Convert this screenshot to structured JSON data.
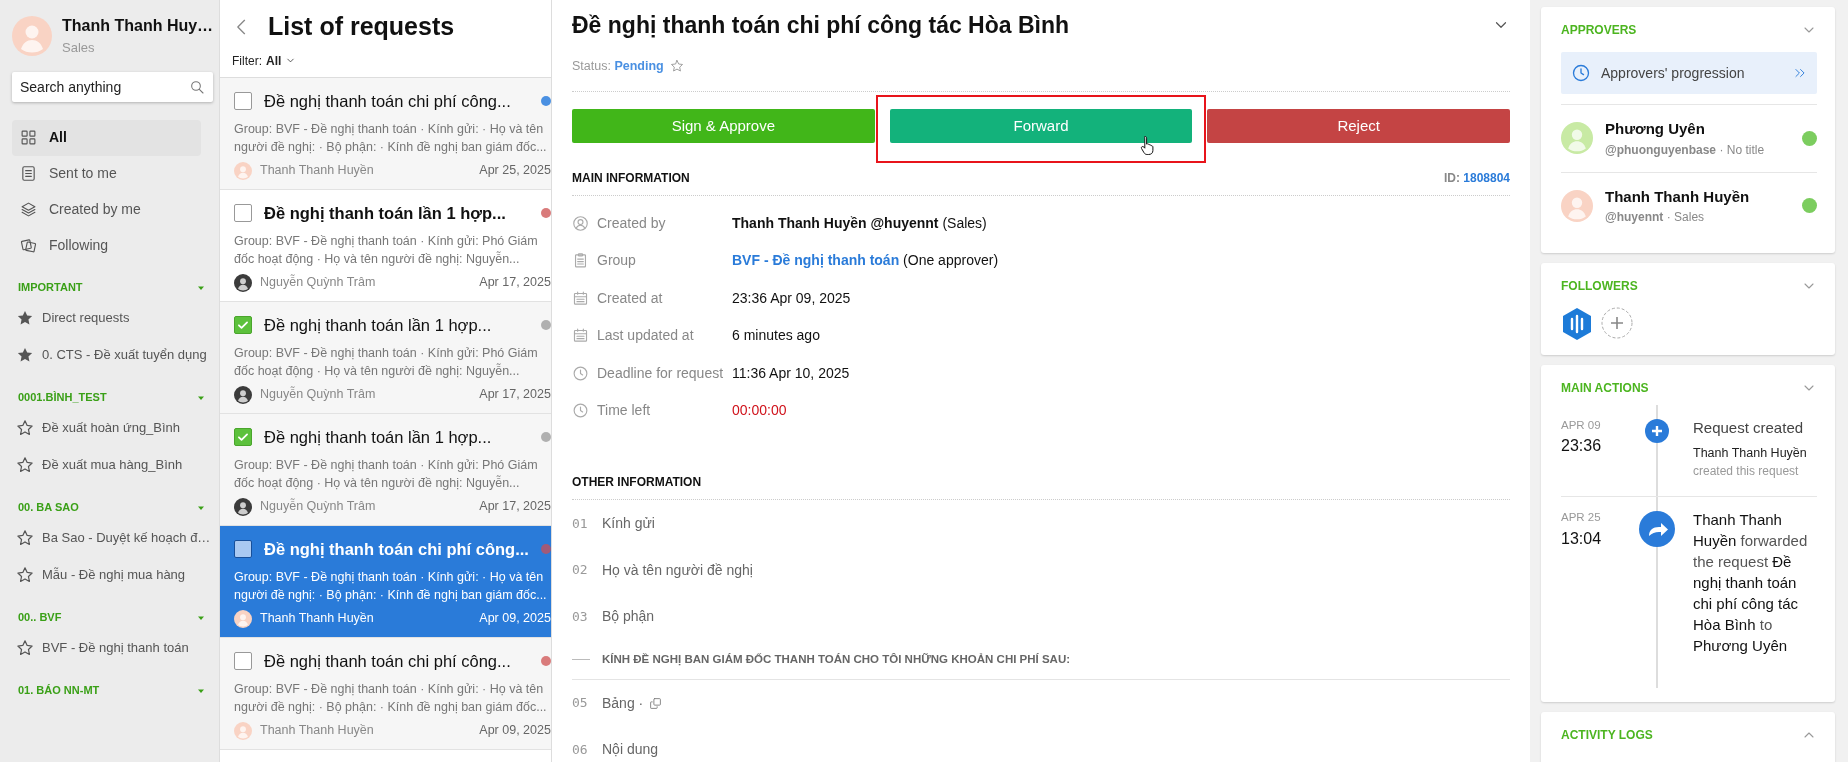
{
  "sidebar": {
    "user": {
      "name": "Thanh Thanh Huy…",
      "role": "Sales",
      "avatar": {
        "color": "#f9d3c4"
      }
    },
    "search": {
      "placeholder": "Search anything"
    },
    "nav": [
      {
        "label": "All",
        "selected": true
      },
      {
        "label": "Sent to me",
        "selected": false
      },
      {
        "label": "Created by me",
        "selected": false
      },
      {
        "label": "Following",
        "selected": false
      }
    ],
    "groups": [
      {
        "title": "IMPORTANT",
        "expanded": true,
        "items": [
          {
            "label": "Direct requests",
            "starred": true
          },
          {
            "label": "0. CTS - Đề xuất tuyển dụng",
            "starred": true
          }
        ]
      },
      {
        "title": "0001.BÌNH_TEST",
        "expanded": true,
        "items": [
          {
            "label": "Đề xuất hoàn ứng_Bình",
            "starred": false
          },
          {
            "label": "Đề xuất mua hàng_Bình",
            "starred": false
          }
        ]
      },
      {
        "title": "00. BA SAO",
        "expanded": true,
        "items": [
          {
            "label": "Ba Sao - Duyệt kế hoạch đ…",
            "starred": false
          },
          {
            "label": "Mẫu - Đề nghị mua hàng",
            "starred": false
          }
        ]
      },
      {
        "title": "00.. BVF",
        "expanded": true,
        "items": [
          {
            "label": "BVF - Đề nghị thanh toán",
            "starred": false
          }
        ]
      },
      {
        "title": "01. BÁO NN-MT",
        "expanded": true
      }
    ]
  },
  "requests": {
    "title": "List of requests",
    "filter_label": "Filter:",
    "filter_value": "All",
    "items": [
      {
        "title": "Đề nghị thanh toán chi phí công...",
        "unread": false,
        "checked": false,
        "selected": false,
        "color": "#4a90e2",
        "summary": "Group: BVF - Đề nghị thanh toán · Kính gửi: · Họ và tên người đề nghị: · Bộ phận: · Kính đề nghị ban giám đốc...",
        "author": "Thanh Thanh Huyền",
        "avatar": {
          "color": "#f9d3c4"
        },
        "date": "Apr 25, 2025"
      },
      {
        "title": "Đề nghị thanh toán lần 1 hợp...",
        "unread": true,
        "checked": false,
        "selected": false,
        "color": "#d97b7b",
        "summary": "Group: BVF - Đề nghị thanh toán · Kính gửi: Phó Giám đốc hoạt động · Họ và tên người đề nghị: Nguyễn...",
        "author": "Nguyễn Quỳnh Trâm",
        "avatar": {
          "color": "#3b3b3b"
        },
        "date": "Apr 17, 2025"
      },
      {
        "title": "Đề nghị thanh toán lần 1 hợp...",
        "unread": false,
        "checked": true,
        "selected": false,
        "color": "#b0b0b0",
        "summary": "Group: BVF - Đề nghị thanh toán · Kính gửi: Phó Giám đốc hoạt động · Họ và tên người đề nghị: Nguyễn...",
        "author": "Nguyễn Quỳnh Trâm",
        "avatar": {
          "color": "#3b3b3b"
        },
        "date": "Apr 17, 2025"
      },
      {
        "title": "Đề nghị thanh toán lần 1 hợp...",
        "unread": false,
        "checked": true,
        "selected": false,
        "color": "#b0b0b0",
        "summary": "Group: BVF - Đề nghị thanh toán · Kính gửi: Phó Giám đốc hoạt động · Họ và tên người đề nghị: Nguyễn...",
        "author": "Nguyễn Quỳnh Trâm",
        "avatar": {
          "color": "#3b3b3b"
        },
        "date": "Apr 17, 2025"
      },
      {
        "title": "Đề nghị thanh toán chi phí công...",
        "unread": true,
        "checked": false,
        "selected": true,
        "color": "#a05a78",
        "summary": "Group: BVF - Đề nghị thanh toán · Kính gửi: · Họ và tên người đề nghị: · Bộ phận: · Kính đề nghị ban giám đốc...",
        "author": "Thanh Thanh Huyền",
        "avatar": {
          "color": "#f9d3c4"
        },
        "date": "Apr 09, 2025"
      },
      {
        "title": "Đề nghị thanh toán chi phí công...",
        "unread": false,
        "checked": false,
        "selected": false,
        "color": "#d97b7b",
        "summary": "Group: BVF - Đề nghị thanh toán · Kính gửi: · Họ và tên người đề nghị: · Bộ phận: · Kính đề nghị ban giám đốc...",
        "author": "Thanh Thanh Huyền",
        "avatar": {
          "color": "#f9d3c4"
        },
        "date": "Apr 09, 2025"
      }
    ]
  },
  "detail": {
    "title": "Đề nghị thanh toán chi phí công tác Hòa Bình",
    "status_label": "Status:",
    "status": "Pending",
    "starred": false,
    "buttons": [
      {
        "kind": "approve",
        "label": "Sign & Approve",
        "highlighted": false
      },
      {
        "kind": "forward",
        "label": "Forward",
        "highlighted": true
      },
      {
        "kind": "reject",
        "label": "Reject",
        "highlighted": false
      }
    ],
    "main_info": {
      "title": "MAIN INFORMATION",
      "id_label": "ID:",
      "id": "1808804",
      "rows": [
        {
          "label": "Created by",
          "value": "**Thanh Thanh Huyền @huyennt** (Sales)"
        },
        {
          "label": "Group",
          "link": "BVF - Đề nghị thanh toán",
          "value": "(One approver)"
        },
        {
          "label": "Created at",
          "value": "23:36 Apr 09, 2025"
        },
        {
          "label": "Last updated at",
          "value": "6 minutes ago"
        },
        {
          "label": "Deadline for request",
          "value": "11:36 Apr 10, 2025"
        },
        {
          "label": "Time left",
          "value": "00:00:00",
          "overdue": true
        }
      ]
    },
    "other_info": {
      "title": "OTHER INFORMATION",
      "fields": [
        {
          "kind": "field",
          "number": "01",
          "label": "Kính gửi"
        },
        {
          "kind": "field",
          "number": "02",
          "label": "Họ và tên người đề nghị"
        },
        {
          "kind": "field",
          "number": "03",
          "label": "Bộ phận"
        },
        {
          "kind": "section",
          "label": "KÍNH ĐỀ NGHỊ BAN GIÁM ĐỐC THANH TOÁN CHO TÔI NHỮNG KHOẢN CHI PHÍ SAU:"
        },
        {
          "kind": "table",
          "number": "05",
          "label": "Bảng ·"
        },
        {
          "kind": "field",
          "number": "06",
          "label": "Nội dung"
        }
      ]
    }
  },
  "panel": {
    "approvers": {
      "title": "APPROVERS",
      "expanded": true,
      "progression": "Approvers' progression",
      "people": [
        {
          "name": "Phương Uyên",
          "sub": "**@phuonguyenbase** · No title",
          "avatar": {
            "color": "#c8eaa4"
          },
          "color": "#7ccd5f"
        },
        {
          "name": "Thanh Thanh Huyền",
          "sub": "**@huyennt** · Sales",
          "avatar": {
            "color": "#f9d3c4"
          },
          "color": "#7ccd5f"
        }
      ]
    },
    "followers": {
      "title": "FOLLOWERS",
      "expanded": true
    },
    "main_actions": {
      "title": "MAIN ACTIONS",
      "expanded": true,
      "entries": [
        {
          "kind": "created",
          "date": "APR 09",
          "time": "23:36",
          "headline": "Request created",
          "actor": "Thanh Thanh Huyền",
          "note": "created this request"
        },
        {
          "kind": "forwarded",
          "date": "APR 25",
          "time": "13:04",
          "text": "**Thanh Thanh Huyền** forwarded the request **Đề nghị thanh toán chi phí công tác Hòa Bình** to **Phương Uyên**"
        }
      ]
    },
    "activity_logs": {
      "title": "ACTIVITY LOGS",
      "expanded": false
    }
  }
}
